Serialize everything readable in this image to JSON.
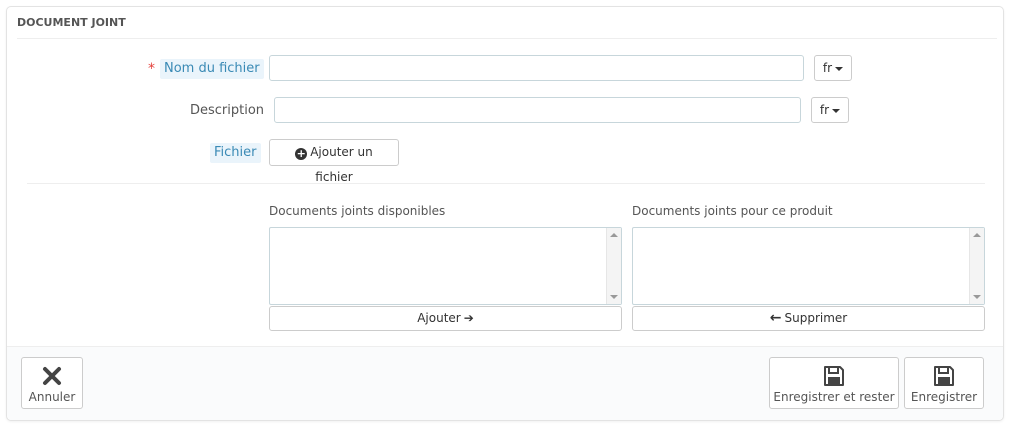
{
  "panel": {
    "title": "DOCUMENT JOINT"
  },
  "form": {
    "filename": {
      "required_mark": "*",
      "label": "Nom du fichier",
      "value": "",
      "lang": "fr"
    },
    "description": {
      "label": "Description",
      "value": "",
      "lang": "fr"
    },
    "file": {
      "label": "Fichier",
      "button_label": "Ajouter un fichier"
    }
  },
  "attachments": {
    "available_title": "Documents joints disponibles",
    "product_title": "Documents joints pour ce produit",
    "add_button": "Ajouter",
    "remove_button": "Supprimer"
  },
  "footer": {
    "cancel_label": "Annuler",
    "save_stay_label": "Enregistrer et rester",
    "save_label": "Enregistrer"
  },
  "colors": {
    "required": "#e4413c",
    "hint_bg": "#eaf4fb",
    "hint_text": "#3a8ab5",
    "border": "#c7d6db"
  },
  "icons": {
    "add_file": "plus-circle-icon",
    "add_arrow": "arrow-right-icon",
    "remove_arrow": "arrow-left-icon",
    "cancel": "close-icon",
    "save": "floppy-disk-icon"
  }
}
